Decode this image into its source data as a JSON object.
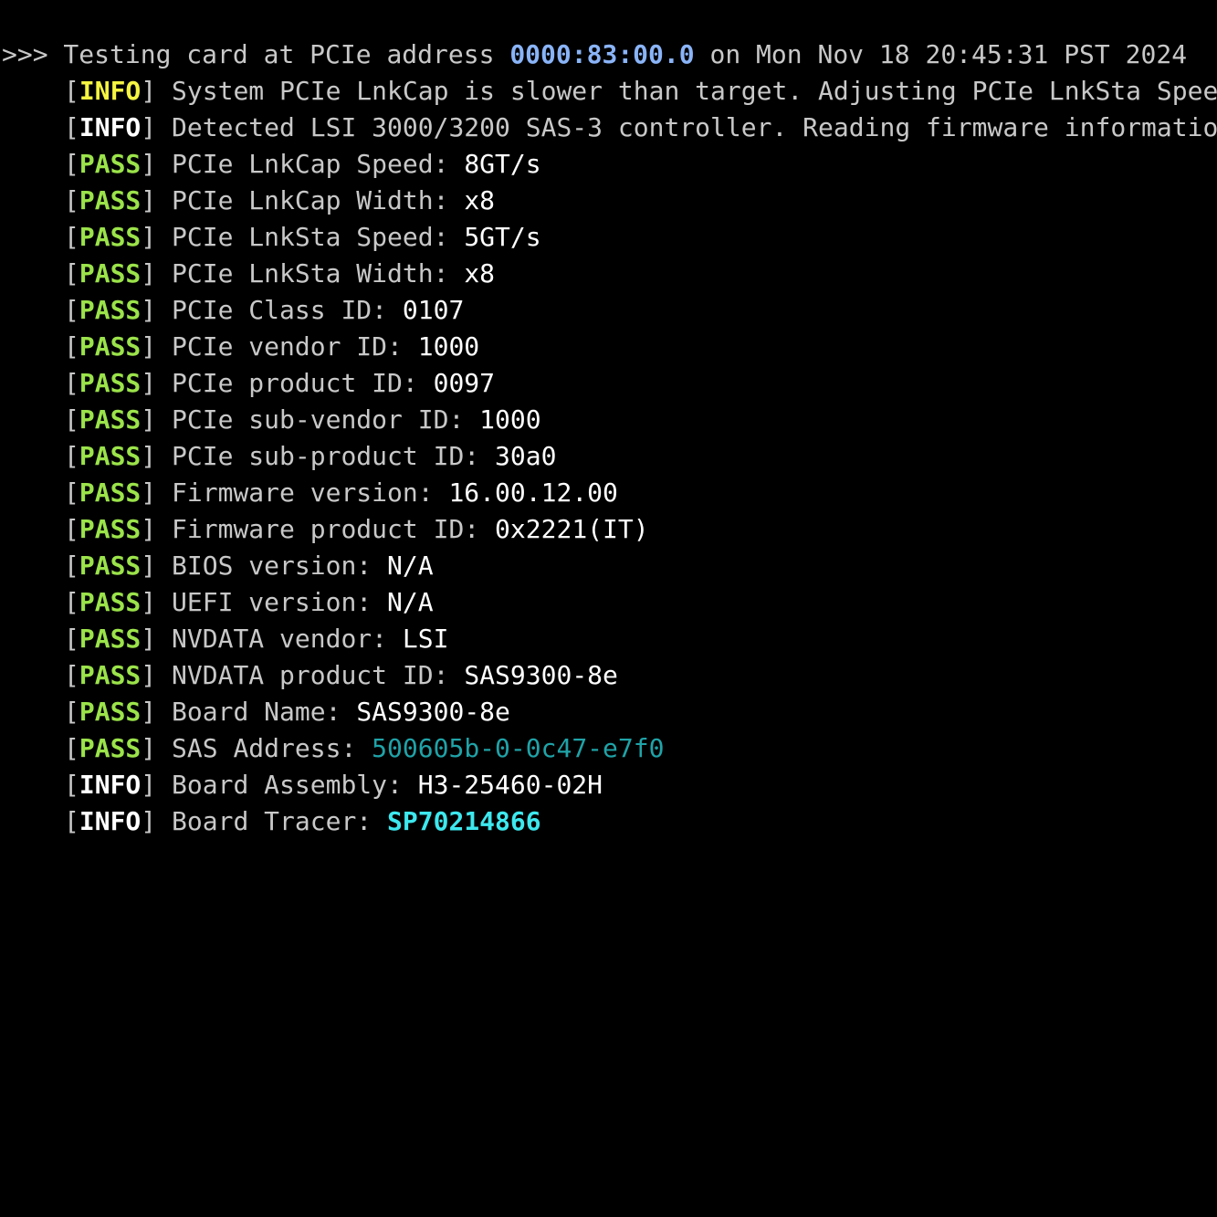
{
  "header": {
    "prompt": ">>>",
    "prefix": " Testing card at PCIe address ",
    "address": "0000:83:00.0",
    "suffix": " on Mon Nov 18 20:45:31 PST 2024"
  },
  "lines": [
    {
      "tag": "INFO",
      "tag_style": "yellow",
      "label": "System PCIe LnkCap is slower than target. Adjusting PCIe LnkSta Spee",
      "value": "",
      "value_style": "plain"
    },
    {
      "tag": "INFO",
      "tag_style": "white",
      "label": "Detected LSI 3000/3200 SAS-3 controller. Reading firmware informatio",
      "value": "",
      "value_style": "plain"
    },
    {
      "tag": "PASS",
      "tag_style": "pass",
      "label": "PCIe LnkCap Speed: ",
      "value": "8GT/s",
      "value_style": "plain"
    },
    {
      "tag": "PASS",
      "tag_style": "pass",
      "label": "PCIe LnkCap Width: ",
      "value": "x8",
      "value_style": "plain"
    },
    {
      "tag": "PASS",
      "tag_style": "pass",
      "label": "PCIe LnkSta Speed: ",
      "value": "5GT/s",
      "value_style": "plain"
    },
    {
      "tag": "PASS",
      "tag_style": "pass",
      "label": "PCIe LnkSta Width: ",
      "value": "x8",
      "value_style": "plain"
    },
    {
      "tag": "PASS",
      "tag_style": "pass",
      "label": "PCIe Class ID: ",
      "value": "0107",
      "value_style": "plain"
    },
    {
      "tag": "PASS",
      "tag_style": "pass",
      "label": "PCIe vendor ID: ",
      "value": "1000",
      "value_style": "plain"
    },
    {
      "tag": "PASS",
      "tag_style": "pass",
      "label": "PCIe product ID: ",
      "value": "0097",
      "value_style": "plain"
    },
    {
      "tag": "PASS",
      "tag_style": "pass",
      "label": "PCIe sub-vendor ID: ",
      "value": "1000",
      "value_style": "plain"
    },
    {
      "tag": "PASS",
      "tag_style": "pass",
      "label": "PCIe sub-product ID: ",
      "value": "30a0",
      "value_style": "plain"
    },
    {
      "tag": "PASS",
      "tag_style": "pass",
      "label": "Firmware version: ",
      "value": "16.00.12.00",
      "value_style": "plain"
    },
    {
      "tag": "PASS",
      "tag_style": "pass",
      "label": "Firmware product ID: ",
      "value": "0x2221(IT)",
      "value_style": "plain"
    },
    {
      "tag": "PASS",
      "tag_style": "pass",
      "label": "BIOS version: ",
      "value": "N/A",
      "value_style": "plain"
    },
    {
      "tag": "PASS",
      "tag_style": "pass",
      "label": "UEFI version: ",
      "value": "N/A",
      "value_style": "plain"
    },
    {
      "tag": "PASS",
      "tag_style": "pass",
      "label": "NVDATA vendor: ",
      "value": "LSI",
      "value_style": "plain"
    },
    {
      "tag": "PASS",
      "tag_style": "pass",
      "label": "NVDATA product ID: ",
      "value": "SAS9300-8e",
      "value_style": "plain"
    },
    {
      "tag": "PASS",
      "tag_style": "pass",
      "label": "Board Name: ",
      "value": "SAS9300-8e",
      "value_style": "plain"
    },
    {
      "tag": "PASS",
      "tag_style": "pass",
      "label": "SAS Address: ",
      "value": "500605b-0-0c47-e7f0",
      "value_style": "teal"
    },
    {
      "tag": "INFO",
      "tag_style": "white",
      "label": "Board Assembly: ",
      "value": "H3-25460-02H",
      "value_style": "plain"
    },
    {
      "tag": "INFO",
      "tag_style": "white",
      "label": "Board Tracer: ",
      "value": "SP70214866",
      "value_style": "cyan"
    }
  ],
  "colors": {
    "background": "#000000",
    "text": "#c8c8c8",
    "address": "#8ab4f8",
    "info_yellow": "#f5f542",
    "info_white": "#ffffff",
    "pass": "#9be34a",
    "teal": "#1fa3a8",
    "cyan": "#3de8ee"
  }
}
